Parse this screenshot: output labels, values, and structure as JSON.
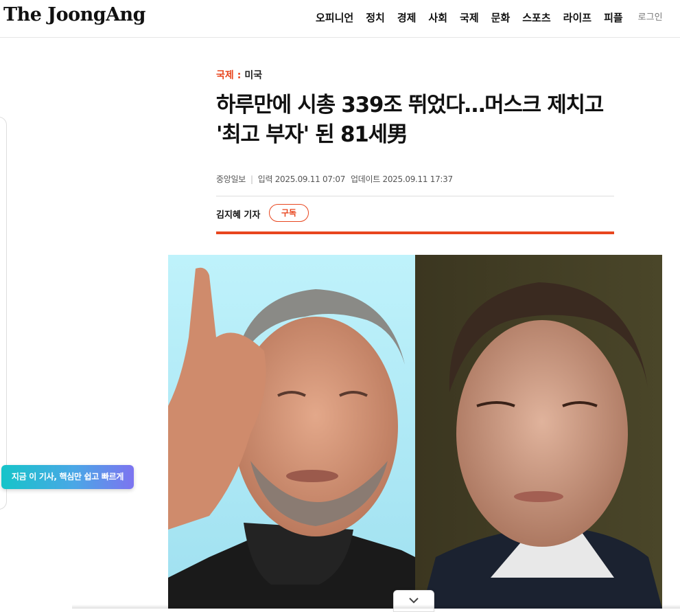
{
  "site": {
    "logo": "The JoongAng"
  },
  "nav": {
    "items": [
      "오피니언",
      "정치",
      "경제",
      "사회",
      "국제",
      "문화",
      "스포츠",
      "라이프",
      "피플"
    ],
    "login": "로그인"
  },
  "floating": {
    "summary_label": "지금 이 기사, 핵심만 쉽고 빠르게"
  },
  "article": {
    "category": "국제",
    "separator": ":",
    "subcategory": "미국",
    "headline_line1": "하루만에 시총 339조 뛰었다…머스크 제치고",
    "headline_line2": "'최고 부자' 된 81세男",
    "source": "중앙일보",
    "published_label": "입력",
    "published": "2025.09.11 07:07",
    "updated_label": "업데이트",
    "updated": "2025.09.11 17:37",
    "author": "김지혜 기자",
    "subscribe_label": "구독"
  },
  "colors": {
    "accent": "#e8461e",
    "text": "#111111",
    "muted": "#555555"
  },
  "icons": {
    "scroll": "chevron-down-icon"
  }
}
